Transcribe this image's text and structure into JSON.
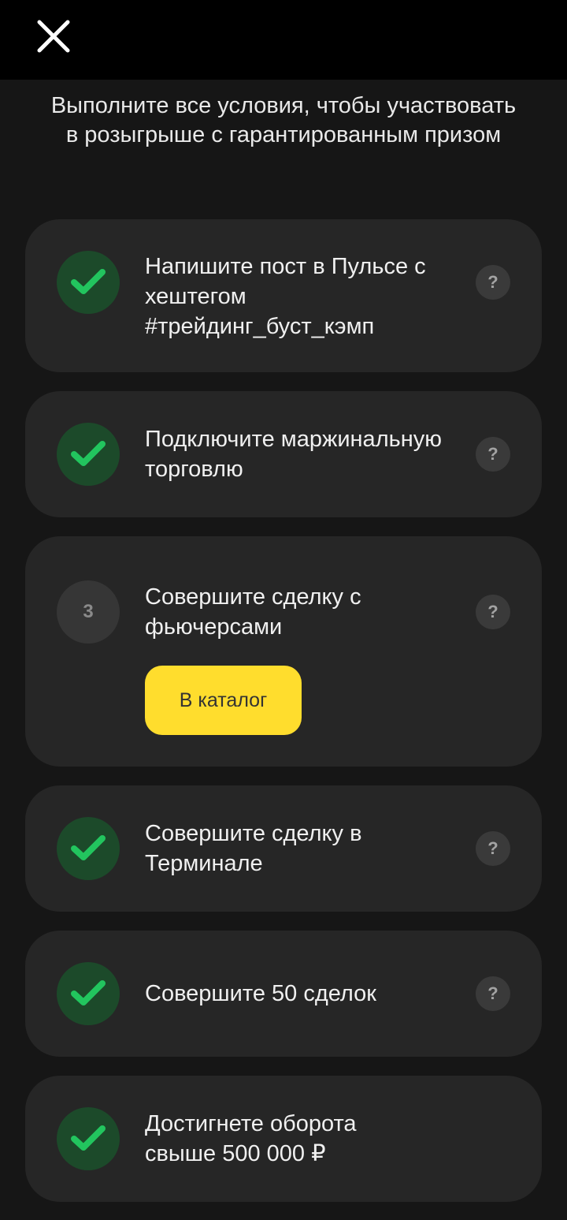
{
  "header": {
    "close_icon": "close-icon"
  },
  "headline": "Выполните все условия, чтобы участвовать в розыгрыше с гарантированным призом",
  "colors": {
    "background": "#161616",
    "card": "#262626",
    "done": "#1c4a2a",
    "check": "#22c55e",
    "accent": "#ffdd2d"
  },
  "tasks": [
    {
      "status": "done",
      "icon": "checkmark-icon",
      "text": "Напишите пост в Пульсе с хештегом #трейдинг_буст_кэмп",
      "help": "?"
    },
    {
      "status": "done",
      "icon": "checkmark-icon",
      "text": "Подключите маржинальную торговлю",
      "help": "?"
    },
    {
      "status": "pending",
      "number": "3",
      "text": "Совершите сделку с фьючерсами",
      "help": "?",
      "button": "В каталог"
    },
    {
      "status": "done",
      "icon": "checkmark-icon",
      "text": "Совершите сделку в Терминале",
      "help": "?"
    },
    {
      "status": "done",
      "icon": "checkmark-icon",
      "text": "Совершите 50 сделок",
      "help": "?"
    },
    {
      "status": "done",
      "icon": "checkmark-icon",
      "text": "Достигнете оборота свыше 500 000 ₽"
    }
  ]
}
